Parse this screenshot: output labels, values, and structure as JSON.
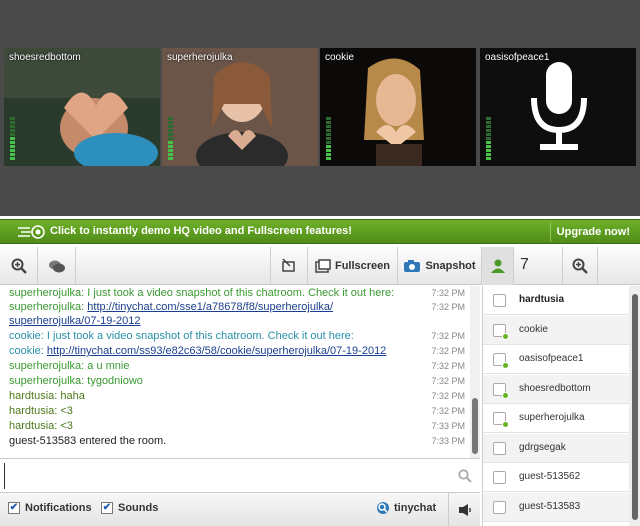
{
  "cameras": [
    {
      "name": "shoesredbottom",
      "vu_level": 0.55
    },
    {
      "name": "superherojulka",
      "vu_level": 0.45
    },
    {
      "name": "cookie",
      "vu_level": 0.4
    },
    {
      "name": "oasisofpeace1",
      "vu_level": 0.45,
      "audio_only": true
    }
  ],
  "banner": {
    "promo_text": "Click to instantly demo HQ video and Fullscreen features!",
    "upgrade_label": "Upgrade now!"
  },
  "toolbar": {
    "fullscreen_label": "Fullscreen",
    "snapshot_label": "Snapshot",
    "user_count": "7"
  },
  "messages": [
    {
      "text": "superherojulka: I just took a video snapshot of this chatroom. Check it out here:",
      "time": "7:32 PM",
      "color": "green"
    },
    {
      "prefix": "superherojulka: ",
      "link": "http://tinychat.com/sse1/a78678/f8/superherojulka/",
      "time": "7:32 PM",
      "color": "green"
    },
    {
      "link": "superherojulka/07-19-2012",
      "time": "",
      "color": "green"
    },
    {
      "text": "cookie: I just took a video snapshot of this chatroom. Check it out here:",
      "time": "7:32 PM",
      "color": "teal"
    },
    {
      "prefix": "cookie: ",
      "link": "http://tinychat.com/ss93/e82c63/58/cookie/superherojulka/07-19-2012",
      "time": "7:32 PM",
      "color": "teal"
    },
    {
      "text": "superherojulka: a u mnie",
      "time": "7:32 PM",
      "color": "green"
    },
    {
      "text": "superherojulka: tygodniowo",
      "time": "7:32 PM",
      "color": "green"
    },
    {
      "text": "hardtusia: haha",
      "time": "7:32 PM",
      "color": "dark"
    },
    {
      "text": "hardtusia: <3",
      "time": "7:32 PM",
      "color": "dark"
    },
    {
      "text": "hardtusia: <3",
      "time": "7:33 PM",
      "color": "dark"
    },
    {
      "text": "guest-513583 entered the room.",
      "time": "7:33 PM",
      "color": "black"
    }
  ],
  "input": {
    "value": "",
    "placeholder": ""
  },
  "bottom": {
    "notifications_label": "Notifications",
    "sounds_label": "Sounds",
    "brand_label": "tinychat"
  },
  "users": [
    {
      "name": "hardtusia",
      "bold": true,
      "online": false
    },
    {
      "name": "cookie",
      "bold": false,
      "online": true
    },
    {
      "name": "oasisofpeace1",
      "bold": false,
      "online": true
    },
    {
      "name": "shoesredbottom",
      "bold": false,
      "online": true
    },
    {
      "name": "superherojulka",
      "bold": false,
      "online": true
    },
    {
      "name": "gdrgsegak",
      "bold": false,
      "online": false
    },
    {
      "name": "guest-513562",
      "bold": false,
      "online": false
    },
    {
      "name": "guest-513583",
      "bold": false,
      "online": false
    }
  ],
  "colors": {
    "accent_green": "#5a9e1f",
    "link": "#1b3f8f"
  }
}
